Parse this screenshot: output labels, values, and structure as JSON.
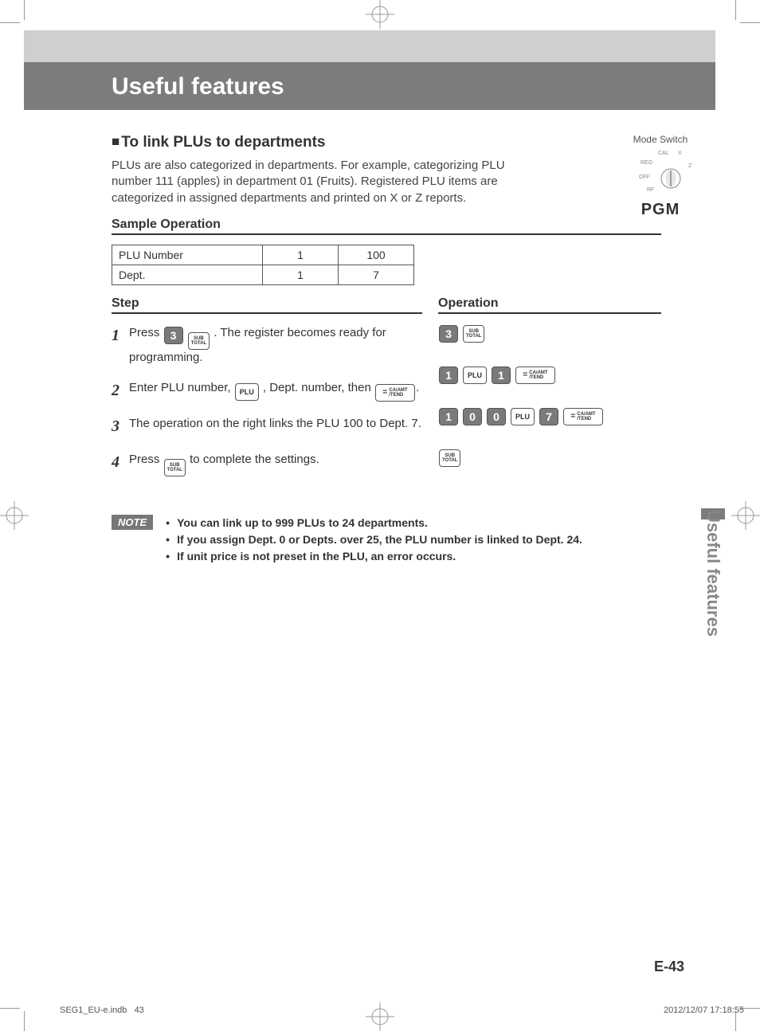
{
  "header": {
    "title": "Useful features"
  },
  "mode_switch": {
    "label": "Mode Switch",
    "positions": [
      "CAL",
      "X",
      "REG",
      "Z",
      "OFF",
      "RF"
    ],
    "selected": "PGM"
  },
  "section": {
    "title": "To link PLUs to departments",
    "intro": "PLUs are also categorized in departments. For example, categorizing PLU number 111 (apples) in department 01 (Fruits). Registered PLU items are categorized in assigned departments and printed on X or Z reports.",
    "sample_label": "Sample Operation"
  },
  "table": {
    "rows": [
      {
        "label": "PLU Number",
        "c1": "1",
        "c2": "100"
      },
      {
        "label": "Dept.",
        "c1": "1",
        "c2": "7"
      }
    ]
  },
  "columns": {
    "step_head": "Step",
    "op_head": "Operation"
  },
  "steps": [
    {
      "n": "1",
      "pre": "Press ",
      "mid_keys": [
        "3",
        "SUBTOTAL"
      ],
      "post": ". The register becomes ready for programming."
    },
    {
      "n": "2",
      "pre": "Enter PLU number, ",
      "mid_keys": [
        "PLU"
      ],
      "post": ", Dept. number, then ",
      "end_keys": [
        "CAAMT"
      ],
      "tail": "."
    },
    {
      "n": "3",
      "pre": "The operation on the right links the PLU 100 to Dept. 7."
    },
    {
      "n": "4",
      "pre": "Press ",
      "mid_keys": [
        "SUBTOTAL"
      ],
      "post": " to complete the settings."
    }
  ],
  "ops": [
    [
      "3",
      "SUBTOTAL"
    ],
    [
      "1",
      "PLU",
      "1",
      "CAAMT"
    ],
    [
      "1",
      "0",
      "0",
      "PLU",
      "7",
      "CAAMT"
    ],
    [
      "SUBTOTAL"
    ]
  ],
  "key_labels": {
    "SUBTOTAL_top": "SUB",
    "SUBTOTAL_bot": "TOTAL",
    "PLU": "PLU",
    "CAAMT_eq": "=",
    "CAAMT_top": "CA/AMT",
    "CAAMT_bot": "/TEND"
  },
  "note": {
    "badge": "NOTE",
    "items": [
      "You can link up to 999 PLUs to 24 departments.",
      "If you assign Dept. 0 or Depts. over 25, the PLU number is linked to Dept. 24.",
      "If unit price is not preset in the PLU, an error occurs."
    ]
  },
  "side_tab": "Useful features",
  "page_num": "E-43",
  "footer": {
    "left_file": "SEG1_EU-e.indb",
    "left_page": "43",
    "right": "2012/12/07   17:18:55"
  }
}
